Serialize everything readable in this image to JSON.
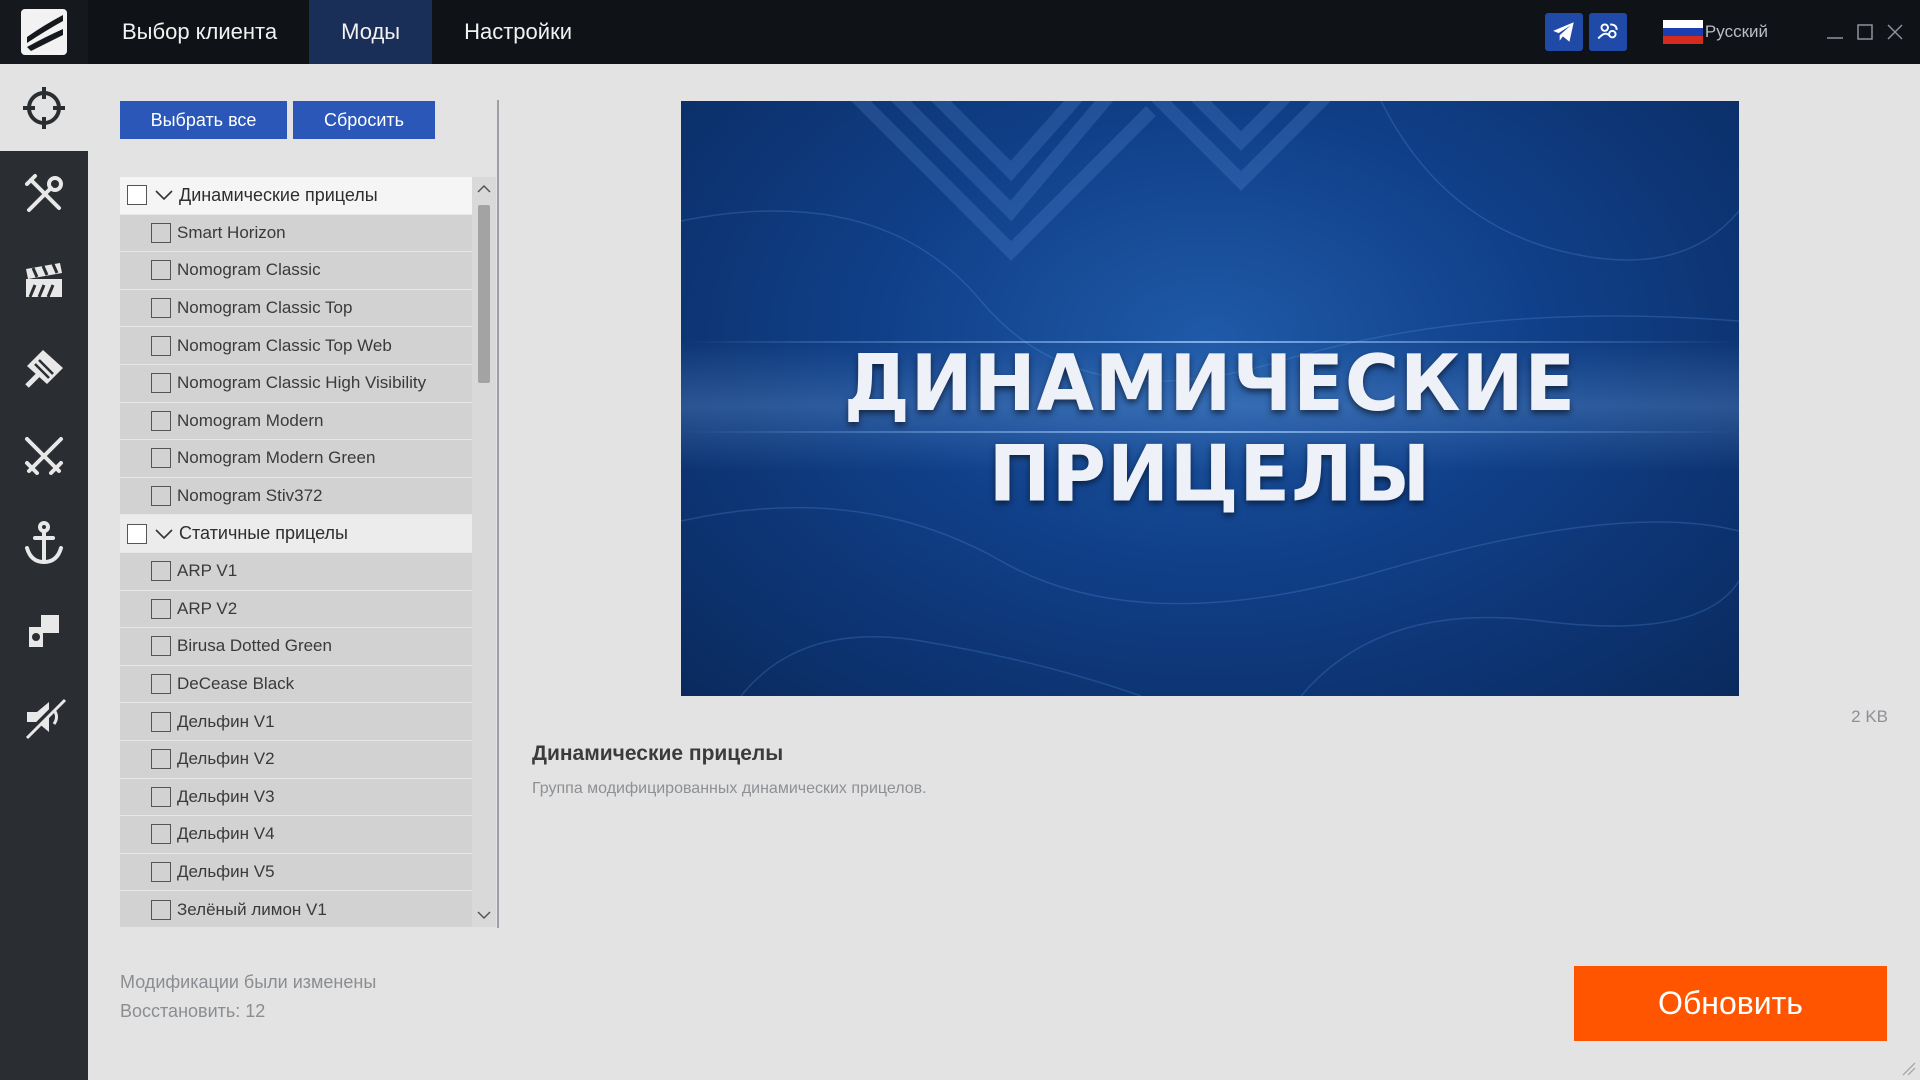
{
  "nav": {
    "tabs": [
      {
        "label": "Выбор клиента",
        "active": false
      },
      {
        "label": "Моды",
        "active": true
      },
      {
        "label": "Настройки",
        "active": false
      }
    ]
  },
  "header": {
    "language": "Русский",
    "social_icons": [
      "telegram-icon",
      "community-icon"
    ],
    "window_controls": [
      "minimize-icon",
      "maximize-icon",
      "close-icon"
    ]
  },
  "sidebar": {
    "items": [
      {
        "icon": "crosshair-icon",
        "active": true
      },
      {
        "icon": "tools-icon",
        "active": false
      },
      {
        "icon": "clapperboard-icon",
        "active": false
      },
      {
        "icon": "flag-icon",
        "active": false
      },
      {
        "icon": "crossed-swords-icon",
        "active": false
      },
      {
        "icon": "anchor-icon",
        "active": false
      },
      {
        "icon": "puzzle-icon",
        "active": false
      },
      {
        "icon": "speaker-mute-icon",
        "active": false
      }
    ]
  },
  "toolbar": {
    "select_all_label": "Выбрать все",
    "reset_label": "Сбросить"
  },
  "tree": {
    "groups": [
      {
        "label": "Динамические прицелы",
        "expanded": true,
        "items": [
          "Smart Horizon",
          "Nomogram Classic",
          "Nomogram Classic Top",
          "Nomogram Classic Top Web",
          "Nomogram Classic High Visibility",
          "Nomogram Modern",
          "Nomogram Modern Green",
          "Nomogram Stiv372"
        ]
      },
      {
        "label": "Статичные прицелы",
        "expanded": true,
        "items": [
          "ARP V1",
          "ARP V2",
          "Birusa Dotted Green",
          "DeCease Black",
          "Дельфин V1",
          "Дельфин V2",
          "Дельфин V3",
          "Дельфин V4",
          "Дельфин V5",
          "Зелёный лимон V1"
        ]
      }
    ]
  },
  "status": {
    "line1": "Модификации были изменены",
    "line2": "Восстановить: 12"
  },
  "preview": {
    "banner_text": "ДИНАМИЧЕСКИЕ ПРИЦЕЛЫ",
    "size": "2 KB",
    "title": "Динамические прицелы",
    "description": "Группа модифицированных динамических прицелов."
  },
  "actions": {
    "update_label": "Обновить"
  },
  "colors": {
    "accent_orange": "#ff5500",
    "button_blue": "#2a57b8",
    "active_tab": "#1a2f57"
  }
}
